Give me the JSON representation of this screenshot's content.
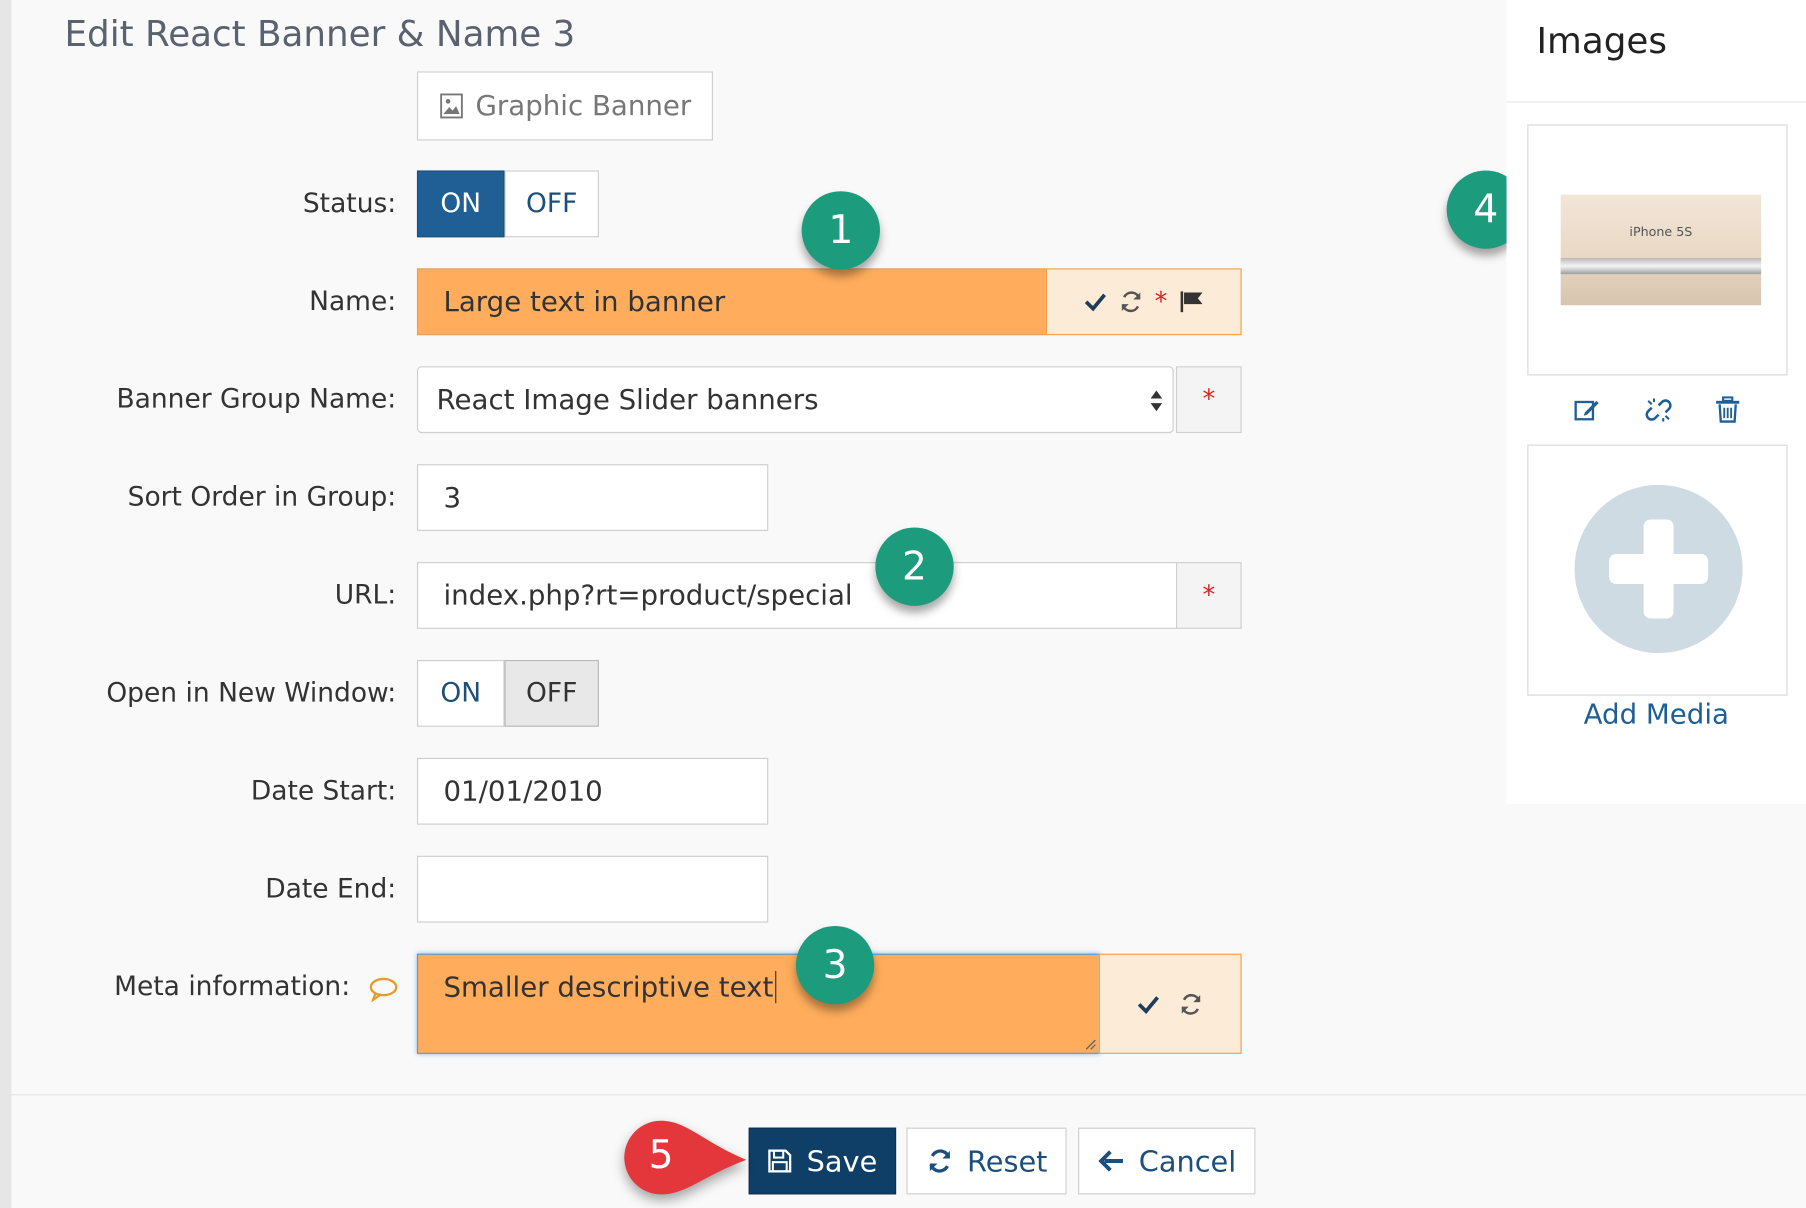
{
  "page": {
    "title": "Edit React Banner & Name 3"
  },
  "graphic_banner_button": {
    "label": "Graphic Banner",
    "icon": "image-icon"
  },
  "form": {
    "status": {
      "label": "Status:",
      "on": "ON",
      "off": "OFF",
      "selected": "ON"
    },
    "name": {
      "label": "Name:",
      "value": "Large text in banner",
      "required_mark": "*"
    },
    "banner_group": {
      "label": "Banner Group Name:",
      "value": "React Image Slider banners",
      "required_mark": "*"
    },
    "sort_order": {
      "label": "Sort Order in Group:",
      "value": "3"
    },
    "url": {
      "label": "URL:",
      "value": "index.php?rt=product/special",
      "required_mark": "*"
    },
    "new_window": {
      "label": "Open in New Window:",
      "on": "ON",
      "off": "OFF",
      "selected": "OFF"
    },
    "date_start": {
      "label": "Date Start:",
      "value": "01/01/2010"
    },
    "date_end": {
      "label": "Date End:",
      "value": ""
    },
    "meta": {
      "label": "Meta information:",
      "value": "Smaller descriptive text"
    }
  },
  "images": {
    "title": "Images",
    "thumbnail_text": "iPhone 5S",
    "add_media_label": "Add Media"
  },
  "footer": {
    "save": "Save",
    "reset": "Reset",
    "cancel": "Cancel"
  },
  "callouts": [
    "1",
    "2",
    "3",
    "4",
    "5"
  ],
  "colors": {
    "highlight": "#ffad5c",
    "primary": "#0f3e66",
    "toggle_active": "#1f5f95",
    "callout_green": "#1d9c7d",
    "callout_red": "#e3373b",
    "required": "#e02020"
  }
}
